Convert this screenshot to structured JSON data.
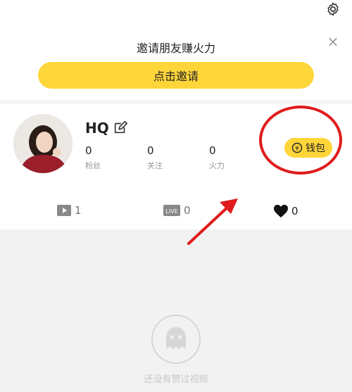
{
  "invite": {
    "title": "邀请朋友赚火力",
    "button_label": "点击邀请",
    "close_symbol": "×"
  },
  "profile": {
    "username": "HQ",
    "stats": [
      {
        "value": "0",
        "label": "粉丝"
      },
      {
        "value": "0",
        "label": "关注"
      },
      {
        "value": "0",
        "label": "火力"
      }
    ],
    "wallet_label": "钱包",
    "wallet_icon_char": "¥"
  },
  "tabs": [
    {
      "icon": "video-icon",
      "count": "1"
    },
    {
      "icon": "live-icon",
      "count": "0"
    },
    {
      "icon": "heart-icon",
      "count": "0"
    }
  ],
  "empty": {
    "message": "还没有赞过视频"
  },
  "colors": {
    "accent_yellow": "#ffd63a",
    "annotation_red": "#e01b1b"
  }
}
